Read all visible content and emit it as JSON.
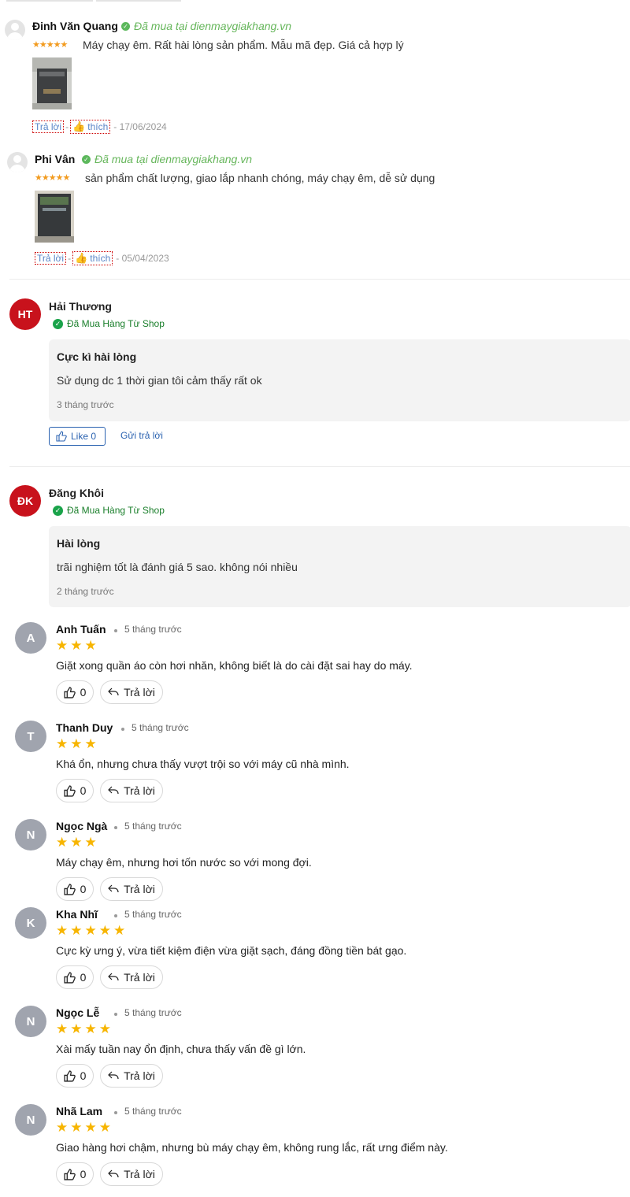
{
  "review_list_a": [
    {
      "name": "Đinh Văn Quang",
      "verified": "Đã mua tại dienmaygiakhang.vn",
      "stars": "★★★★★",
      "text": "Máy chạy êm. Rất hài lòng sản phẩm. Mẫu mã đẹp. Giá cả hợp lý",
      "reply": "Trả lời",
      "like": "thích",
      "date": "- 17/06/2024"
    },
    {
      "name": "Phi Vân",
      "verified": "Đã mua tại dienmaygiakhang.vn",
      "stars": "★★★★★",
      "text": "sản phẩm chất lượng, giao lắp nhanh chóng, máy chạy êm, dễ sử dụng",
      "reply": "Trả lời",
      "like": "thích",
      "date": "- 05/04/2023"
    }
  ],
  "review_list_b": [
    {
      "initials": "HT",
      "name": "Hải Thương",
      "verified": "Đã Mua Hàng Từ Shop",
      "title": "Cực kì hài lòng",
      "content": "Sử dụng dc 1 thời gian tôi cảm thấy rất ok",
      "time": "3 tháng trước",
      "like": "Like 0",
      "reply": "Gửi trả lời"
    },
    {
      "initials": "ĐK",
      "name": "Đăng Khôi",
      "verified": "Đã Mua Hàng Từ Shop",
      "title": "Hài lòng",
      "content": "trãi nghiệm tốt là đánh giá 5 sao. không nói nhiều",
      "time": "2 tháng trước"
    }
  ],
  "review_list_c": [
    {
      "initial": "A",
      "name": "Anh Tuấn",
      "time": "5 tháng trước",
      "stars": "★★★",
      "rating": 3,
      "text": "Giặt xong quần áo còn hơi nhăn, không biết là do cài đặt sai hay do máy.",
      "likes": "0",
      "reply": "Trả lời"
    },
    {
      "initial": "T",
      "name": "Thanh Duy",
      "time": "5 tháng trước",
      "stars": "★★★",
      "rating": 3,
      "text": "Khá ổn, nhưng chưa thấy vượt trội so với máy cũ nhà mình.",
      "likes": "0",
      "reply": "Trả lời"
    },
    {
      "initial": "N",
      "name": "Ngọc Ngà",
      "time": "5 tháng trước",
      "stars": "★★★",
      "rating": 3,
      "text": "Máy chạy êm, nhưng hơi tốn nước so với mong đợi.",
      "likes": "0",
      "reply": "Trả lời"
    },
    {
      "initial": "K",
      "name": "Kha Nhĩ",
      "time": "5 tháng trước",
      "stars": "★★★★★",
      "rating": 5,
      "text": "Cực kỳ ưng ý, vừa tiết kiệm điện vừa giặt sạch, đáng đồng tiền bát gạo.",
      "likes": "0",
      "reply": "Trả lời"
    },
    {
      "initial": "N",
      "name": "Ngọc Lễ",
      "time": "5 tháng trước",
      "stars": "★★★★",
      "rating": 4,
      "text": "Xài mấy tuần nay ổn định, chưa thấy vấn đề gì lớn.",
      "likes": "0",
      "reply": "Trả lời"
    },
    {
      "initial": "N",
      "name": "Nhã Lam",
      "time": "5 tháng trước",
      "stars": "★★★★",
      "rating": 4,
      "text": "Giao hàng hơi chậm, nhưng bù máy chạy êm, không rung lắc, rất ưng điểm này.",
      "likes": "0",
      "reply": "Trả lời"
    }
  ],
  "colors": {
    "brand_red": "#c8121c",
    "star_orange": "#f29b1f",
    "star_yellow": "#f7b500",
    "verified_green": "#1aa34a",
    "link_blue": "#2a62b0"
  }
}
